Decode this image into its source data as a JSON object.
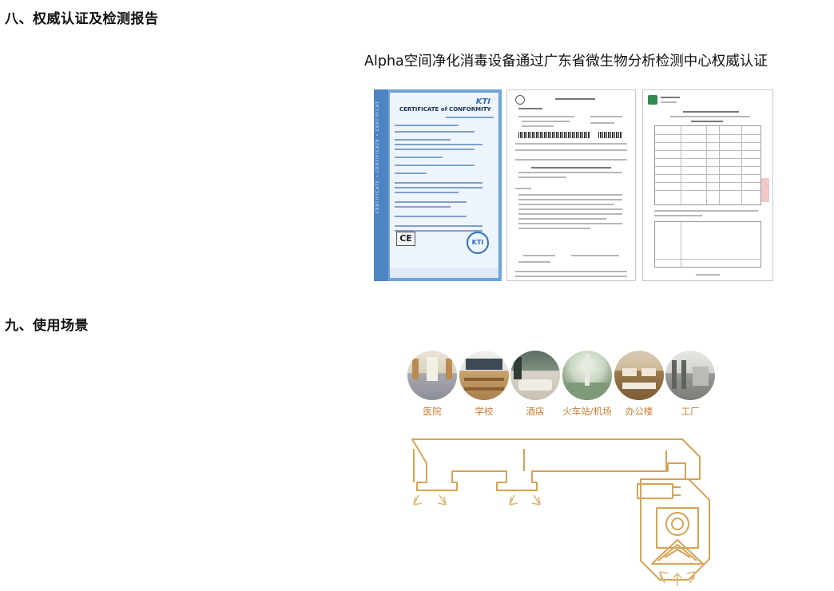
{
  "sections": {
    "cert_heading": "八、权威认证及检测报告",
    "usage_heading": "九、使用场景"
  },
  "cert_caption": "Alpha空间净化消毒设备通过广东省微生物分析检测中心权威认证",
  "certificates": [
    {
      "title": "CERTIFICATE of CONFORMITY",
      "brand": "KTI",
      "mark": "CE",
      "strip_text": "CERTIFICATE • CERTIFICATE • CERTIFICAT"
    },
    {
      "title": ""
    },
    {
      "title": ""
    }
  ],
  "scenes": [
    {
      "label": "医院"
    },
    {
      "label": "学校"
    },
    {
      "label": "酒店"
    },
    {
      "label": "火车站/机场"
    },
    {
      "label": "办公楼"
    },
    {
      "label": "工厂"
    }
  ],
  "colors": {
    "accent": "#c97d35",
    "diagram_line": "#d6a354",
    "cert_blue": "#6fa2d8"
  }
}
